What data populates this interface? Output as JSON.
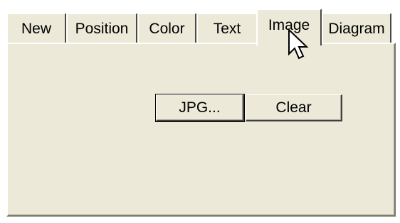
{
  "tabs": [
    {
      "label": "New"
    },
    {
      "label": "Position"
    },
    {
      "label": "Color"
    },
    {
      "label": "Text"
    },
    {
      "label": "Image",
      "selected": true
    },
    {
      "label": "Diagram"
    }
  ],
  "panel": {
    "jpg_button_label": "JPG...",
    "clear_button_label": "Clear"
  },
  "cursor": {
    "icon": "arrow-pointer-icon"
  },
  "colors": {
    "face": "#ece9d8",
    "highlight": "#ffffff",
    "shadow": "#7a786c"
  }
}
